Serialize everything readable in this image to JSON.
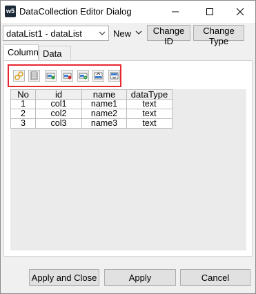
{
  "titlebar": {
    "icon_text": "w5",
    "title": "DataCollection Editor Dialog"
  },
  "toprow": {
    "datalist_value": "dataList1 - dataList",
    "new_label": "New",
    "change_id_label": "Change ID",
    "change_type_label": "Change Type"
  },
  "tabs": [
    {
      "label": "Column"
    },
    {
      "label": "Data"
    }
  ],
  "toolbar_icons": [
    "link-icon",
    "table-icon",
    "add-row-icon",
    "delete-row-icon",
    "insert-row-icon",
    "move-up-icon",
    "move-down-icon"
  ],
  "grid": {
    "headers": [
      "No",
      "id",
      "name",
      "dataType"
    ],
    "rows": [
      [
        "1",
        "col1",
        "name1",
        "text"
      ],
      [
        "2",
        "col2",
        "name2",
        "text"
      ],
      [
        "3",
        "col3",
        "name3",
        "text"
      ]
    ]
  },
  "footer": {
    "apply_close_label": "Apply and Close",
    "apply_label": "Apply",
    "cancel_label": "Cancel"
  },
  "colors": {
    "highlight": "#e8262e",
    "button_bg": "#e1e1e1"
  }
}
